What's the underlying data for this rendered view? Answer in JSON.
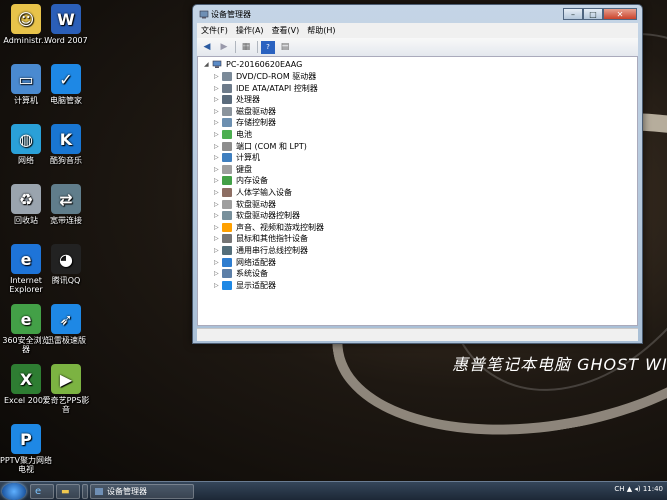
{
  "desktop": {
    "wallpaper_text": "惠普笔记本电脑 GHOST WI",
    "icons": [
      {
        "label": "Administr...",
        "icon": "user-folder-icon",
        "color": "#e8c34a"
      },
      {
        "label": "Word 2007",
        "icon": "word-icon",
        "color": "#2b5fb8"
      },
      {
        "label": "计算机",
        "icon": "computer-icon",
        "color": "#4a8ad0"
      },
      {
        "label": "电脑管家",
        "icon": "shield-icon",
        "color": "#1e88e5"
      },
      {
        "label": "网络",
        "icon": "network-globe-icon",
        "color": "#2aa0d8"
      },
      {
        "label": "酷狗音乐",
        "icon": "kugou-icon",
        "color": "#1976d2"
      },
      {
        "label": "回收站",
        "icon": "recycle-bin-icon",
        "color": "#9aa4ae"
      },
      {
        "label": "宽带连接",
        "icon": "broadband-icon",
        "color": "#607d8b"
      },
      {
        "label": "Internet Explorer",
        "icon": "ie-icon",
        "color": "#1e74d8"
      },
      {
        "label": "腾讯QQ",
        "icon": "qq-penguin-icon",
        "color": "#222222"
      },
      {
        "label": "360安全浏览器",
        "icon": "360-browser-icon",
        "color": "#43a047"
      },
      {
        "label": "迅雷极速版",
        "icon": "thunder-icon",
        "color": "#1e88e5"
      },
      {
        "label": "Excel 2007",
        "icon": "excel-icon",
        "color": "#2e7d32"
      },
      {
        "label": "爱奇艺PPS影音",
        "icon": "iqiyi-icon",
        "color": "#7cb342"
      },
      {
        "label": "PPTV聚力网络电视",
        "icon": "pptv-icon",
        "color": "#1e88e5"
      }
    ]
  },
  "window": {
    "title": "设备管理器",
    "controls": {
      "minimize": "–",
      "maximize": "□",
      "close": "✕"
    },
    "menu": [
      "文件(F)",
      "操作(A)",
      "查看(V)",
      "帮助(H)"
    ],
    "toolbar_icons": [
      "back-arrow-icon",
      "forward-arrow-icon",
      "properties-icon",
      "help-icon",
      "view-icon"
    ],
    "tree": {
      "root": "PC-20160620EAAG",
      "items": [
        {
          "label": "DVD/CD-ROM 驱动器",
          "color": "#7b8a99"
        },
        {
          "label": "IDE ATA/ATAPI 控制器",
          "color": "#6d7b8a"
        },
        {
          "label": "处理器",
          "color": "#5a6b7c"
        },
        {
          "label": "磁盘驱动器",
          "color": "#8a939c"
        },
        {
          "label": "存储控制器",
          "color": "#6c8fb0"
        },
        {
          "label": "电池",
          "color": "#4caf50"
        },
        {
          "label": "端口 (COM 和 LPT)",
          "color": "#8d8d8d"
        },
        {
          "label": "计算机",
          "color": "#3f7fbf"
        },
        {
          "label": "键盘",
          "color": "#9e9e9e"
        },
        {
          "label": "内存设备",
          "color": "#43a047"
        },
        {
          "label": "人体学输入设备",
          "color": "#8d6e63"
        },
        {
          "label": "软盘驱动器",
          "color": "#9e9e9e"
        },
        {
          "label": "软盘驱动器控制器",
          "color": "#78909c"
        },
        {
          "label": "声音、视频和游戏控制器",
          "color": "#ffa000"
        },
        {
          "label": "鼠标和其他指针设备",
          "color": "#757575"
        },
        {
          "label": "通用串行总线控制器",
          "color": "#546e7a"
        },
        {
          "label": "网络适配器",
          "color": "#2e7dd0"
        },
        {
          "label": "系统设备",
          "color": "#5c7fa8"
        },
        {
          "label": "显示适配器",
          "color": "#1e88e5"
        }
      ]
    }
  },
  "taskbar": {
    "buttons": [
      {
        "label": "",
        "icon": "ie-taskbar-icon"
      },
      {
        "label": "",
        "icon": "folder-taskbar-icon"
      },
      {
        "label": "",
        "icon": "media-player-icon"
      },
      {
        "label": "设备管理器",
        "icon": "device-manager-icon"
      }
    ],
    "tray": "CH ▲ ◂) 11:40"
  }
}
